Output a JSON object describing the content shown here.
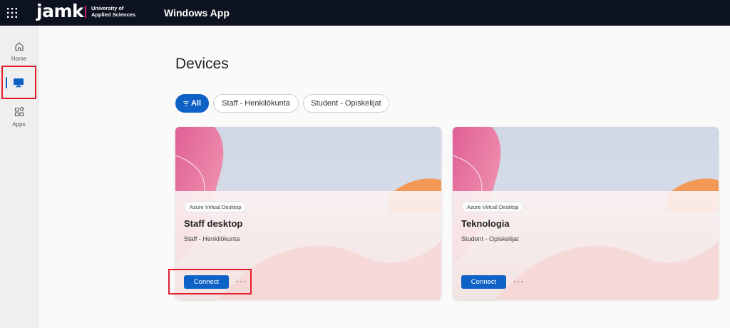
{
  "header": {
    "logo_text": "jamk",
    "logo_sub_line1": "University of",
    "logo_sub_line2": "Applied Sciences",
    "app_title": "Windows App",
    "menu_icon": "waffle-icon"
  },
  "sidebar": {
    "items": [
      {
        "label": "Home",
        "icon": "home-icon"
      },
      {
        "label": "",
        "icon": "monitor-icon",
        "active": true
      },
      {
        "label": "Apps",
        "icon": "apps-icon"
      }
    ]
  },
  "main": {
    "title": "Devices",
    "filters": [
      {
        "label": "All",
        "selected": true,
        "icon": "filter-icon"
      },
      {
        "label": "Staff - Henkilökunta",
        "selected": false
      },
      {
        "label": "Student - Opiskelijat",
        "selected": false
      }
    ],
    "cards": [
      {
        "badge": "Azure Virtual Desktop",
        "name": "Staff desktop",
        "subtitle": "Staff - Henkilökunta",
        "connect_label": "Connect",
        "more_label": "···"
      },
      {
        "badge": "Azure Virtual Desktop",
        "name": "Teknologia",
        "subtitle": "Student - Opiskelijat",
        "connect_label": "Connect",
        "more_label": "···"
      }
    ]
  },
  "colors": {
    "accent": "#0f62c5",
    "topbar": "#0d1220",
    "highlight": "#e4202f",
    "brand_bar": "#d6186f"
  }
}
